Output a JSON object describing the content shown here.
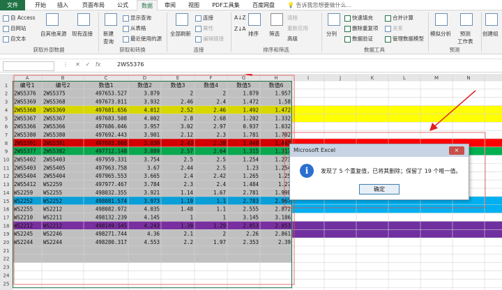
{
  "tabs": {
    "file": "文件",
    "home": "开始",
    "insert": "插入",
    "layout": "页面布局",
    "formulas": "公式",
    "data": "数据",
    "review": "审阅",
    "view": "视图",
    "pdf": "PDF工具集",
    "baidu": "百度网盘",
    "tellme": "告诉我您想要做什么..."
  },
  "ribbon": {
    "ext": {
      "access": "自 Access",
      "web": "自网站",
      "text": "自文本",
      "other": "自其他来源",
      "existing": "现有连接",
      "label": "获取外部数据"
    },
    "transform": {
      "new_query": "新建\n查询",
      "show_query": "显示查询",
      "from_table": "从表格",
      "recent": "最近使用的源",
      "label": "获取和转换"
    },
    "conn": {
      "refresh_all": "全部刷新",
      "connections": "连接",
      "properties": "属性",
      "edit_links": "编辑链接",
      "label": "连接"
    },
    "sort": {
      "sort": "排序",
      "filter": "筛选",
      "clear": "清除",
      "reapply": "重新应用",
      "advanced": "高级",
      "label": "排序和筛选"
    },
    "tools": {
      "split": "分列",
      "flash_fill": "快速填充",
      "remove_dup": "删除重复项",
      "validation": "数据验证",
      "consolidate": "合并计算",
      "relations": "关系",
      "model": "管理数据模型",
      "label": "数据工具"
    },
    "forecast": {
      "whatif": "模拟分析",
      "sheet": "预测\n工作表",
      "label": "预测"
    },
    "outline": {
      "group": "创建组"
    }
  },
  "formula_bar": {
    "name_box": "",
    "formula": "2WS5376",
    "fx": "fx"
  },
  "sheet": {
    "columns": [
      "A",
      "B",
      "C",
      "D",
      "E",
      "F",
      "G",
      "H",
      "I",
      "J",
      "K",
      "L",
      "M",
      "N"
    ],
    "rows": [
      [
        "编号1",
        "编号2",
        "数值1",
        "数值2",
        "数值3",
        "数值4",
        "数值5",
        "数值6"
      ],
      [
        "2WS5376",
        "2WS5375",
        "497653.527",
        "3.879",
        "2",
        "2",
        "1.879",
        "1.957"
      ],
      [
        "2WS5369",
        "2WS5368",
        "497673.811",
        "3.932",
        "2.46",
        "2.4",
        "1.472",
        "1.58"
      ],
      [
        "2WS5368",
        "2WS5369",
        "497681.656",
        "4.012",
        "2.52",
        "2.46",
        "1.492",
        "1.472"
      ],
      [
        "2WS5367",
        "2WS5367",
        "497683.508",
        "4.002",
        "2.8",
        "2.68",
        "1.202",
        "1.332"
      ],
      [
        "2WS5366",
        "2WS5366",
        "497686.046",
        "3.957",
        "3.02",
        "2.97",
        "0.937",
        "1.032"
      ],
      [
        "2WS5380",
        "2WS5380",
        "497692.443",
        "3.901",
        "2.12",
        "2.3",
        "1.781",
        "1.702"
      ],
      [
        "2WS5391",
        "2WS5391",
        "497693.008",
        "3.839",
        "2.43",
        "2.38",
        "1.448",
        "1.461"
      ],
      [
        "2WS5377",
        "2WS5382",
        "497712.148",
        "3.889",
        "2.57",
        "2.64",
        "1.315",
        "1.317"
      ],
      [
        "2WS5402",
        "2WS5403",
        "497959.331",
        "3.754",
        "2.5",
        "2.5",
        "1.254",
        "1.273"
      ],
      [
        "2WS5403",
        "2WS5405",
        "497963.758",
        "3.67",
        "2.44",
        "2.5",
        "1.23",
        "1.254"
      ],
      [
        "2WS5404",
        "2WS5404",
        "497965.553",
        "3.665",
        "2.4",
        "2.42",
        "1.265",
        "1.25"
      ],
      [
        "2WS5412",
        "WS2259",
        "497977.467",
        "3.784",
        "2.3",
        "2.4",
        "1.484",
        "1.27"
      ],
      [
        "WS2259",
        "WS2255",
        "498032.355",
        "3.921",
        "1.14",
        "1.67",
        "2.781",
        "1.998"
      ],
      [
        "WS2252",
        "WS2252",
        "498081.574",
        "3.973",
        "1.19",
        "1.1",
        "2.783",
        "2.967"
      ],
      [
        "WS2255",
        "WS2212",
        "498082.972",
        "4.035",
        "1.48",
        "1.1",
        "2.555",
        "2.872"
      ],
      [
        "WS2210",
        "WS2211",
        "498132.239",
        "4.145",
        "1",
        "1",
        "3.145",
        "3.186"
      ],
      [
        "WS2212",
        "WS2212",
        "498149.545",
        "4.243",
        "1.39",
        "1.29",
        "2.853",
        "2.853"
      ],
      [
        "WS2245",
        "WS2246",
        "498271.744",
        "4.36",
        "2.1",
        "2",
        "2.26",
        "2.861"
      ],
      [
        "WS2244",
        "WS2244",
        "498280.317",
        "4.553",
        "2.2",
        "1.97",
        "2.353",
        "2.39"
      ]
    ],
    "highlight_rows": {
      "4": "#d8d800",
      "8": "#d40000",
      "9": "#0aa84f",
      "15": "#0a9fd8",
      "18": "#7a2fa0"
    },
    "band_colors": [
      "#ffff00",
      "#ff0000",
      "#00b050",
      "#00b0f0",
      "#7030a0"
    ],
    "selection_color": "#c0c0c0",
    "accent": "#217346"
  },
  "dialog": {
    "title": "Microsoft Excel",
    "close": "×",
    "message": "发现了 5 个重复值，已将其删除；保留了 19 个唯一值。",
    "ok": "确定"
  }
}
